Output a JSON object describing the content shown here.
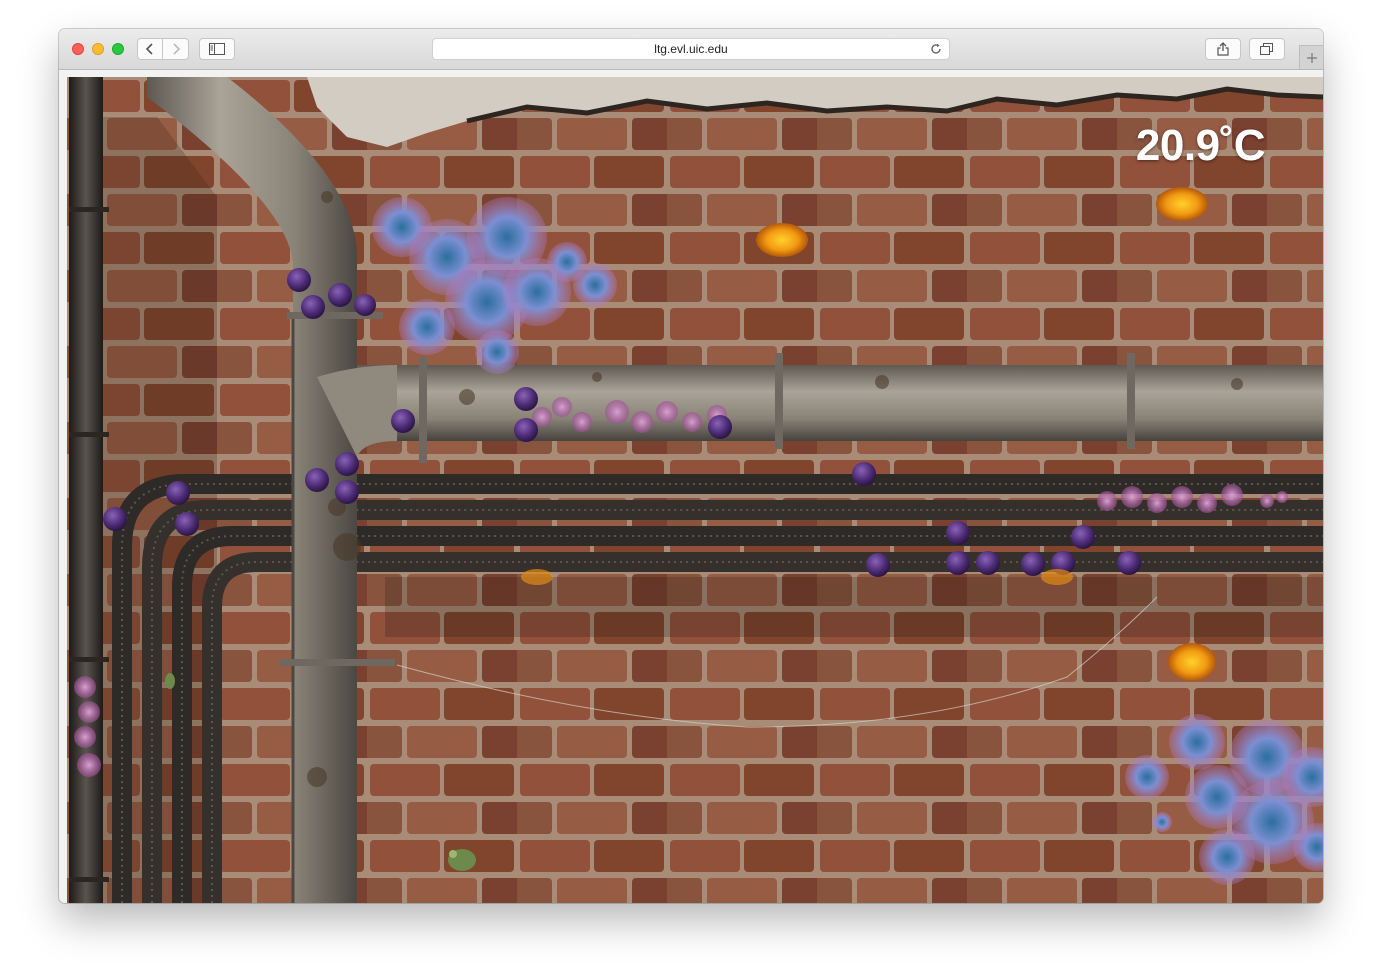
{
  "browser": {
    "url": "ltg.evl.uic.edu"
  },
  "game": {
    "temperature": "20.9˚C"
  },
  "colors": {
    "brick": "#8d4f3a",
    "mortar": "#b8a493",
    "pipe": "#8f8a80",
    "conduit": "#2e2a27",
    "virus_purple": "#4b2a73",
    "colony_blue": "#6f84c8",
    "colony_pink": "#c47fb8",
    "flower_orange": "#f29a12"
  }
}
